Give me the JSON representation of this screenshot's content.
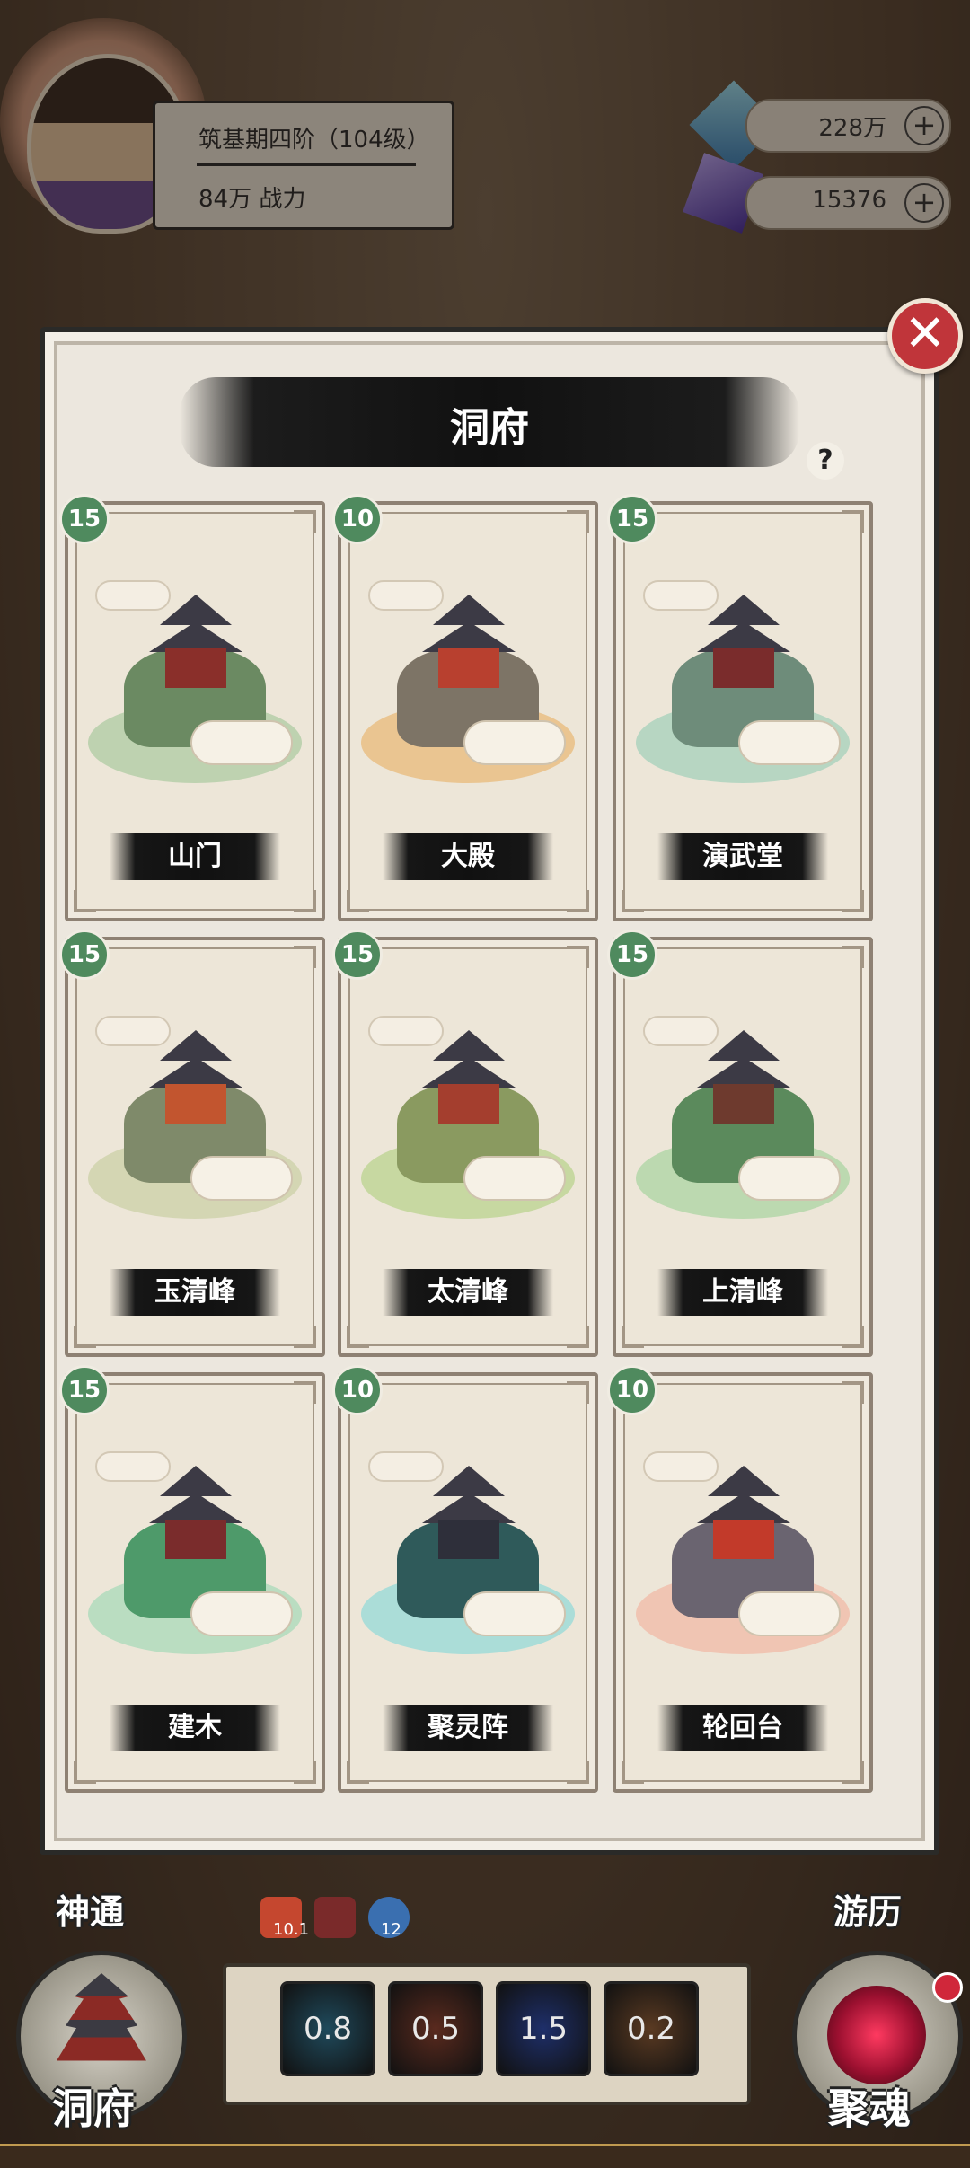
{
  "player": {
    "rank": "筑基期四阶（104级）",
    "power": "84万 战力"
  },
  "resources": [
    {
      "name": "spirit-stone",
      "value": "228万",
      "plus": "+",
      "color": "#5a9ad0"
    },
    {
      "name": "crystal",
      "value": "15376",
      "plus": "+",
      "color": "#6c4fbf"
    }
  ],
  "dialog": {
    "title": "洞府",
    "help": "?",
    "close": "✕"
  },
  "buildings": [
    {
      "name": "山门",
      "level": "15",
      "tint": "#a9c9a0",
      "rock": "#6b8a62",
      "hall": "#8a2f2a"
    },
    {
      "name": "大殿",
      "level": "10",
      "tint": "#e8b673",
      "rock": "#7d7466",
      "hall": "#b8402f"
    },
    {
      "name": "演武堂",
      "level": "15",
      "tint": "#9fcfb9",
      "rock": "#6e8c7a",
      "hall": "#7a2c2c"
    },
    {
      "name": "玉清峰",
      "level": "15",
      "tint": "#c9cfa4",
      "rock": "#7f8a6a",
      "hall": "#c2552f"
    },
    {
      "name": "太清峰",
      "level": "15",
      "tint": "#b6d28a",
      "rock": "#8a9a60",
      "hall": "#a43e2e"
    },
    {
      "name": "上清峰",
      "level": "15",
      "tint": "#a7d3a0",
      "rock": "#5b8a5c",
      "hall": "#6e3a2e"
    },
    {
      "name": "建木",
      "level": "15",
      "tint": "#a4d8b8",
      "rock": "#4e9a6a",
      "hall": "#7a2c2c"
    },
    {
      "name": "聚灵阵",
      "level": "10",
      "tint": "#8fd8d8",
      "rock": "#2f5a5a",
      "hall": "#2e2f3a"
    },
    {
      "name": "轮回台",
      "level": "10",
      "tint": "#f1b6a4",
      "rock": "#6a6470",
      "hall": "#c23a2a"
    }
  ],
  "nav": {
    "left_top": "神通",
    "right_top": "游历",
    "left_bottom": "洞府",
    "right_bottom": "聚魂"
  },
  "buffs": [
    {
      "value": "10.1",
      "color": "#c5472f"
    },
    {
      "value": "",
      "color": "#7a2a2a"
    },
    {
      "value": "12",
      "color": "#3a6fb0"
    }
  ],
  "skills": [
    {
      "value": "0.8",
      "color": "#1f4a5c"
    },
    {
      "value": "0.5",
      "color": "#5a2a1e"
    },
    {
      "value": "1.5",
      "color": "#1e2f6a"
    },
    {
      "value": "0.2",
      "color": "#5a3a22"
    }
  ]
}
